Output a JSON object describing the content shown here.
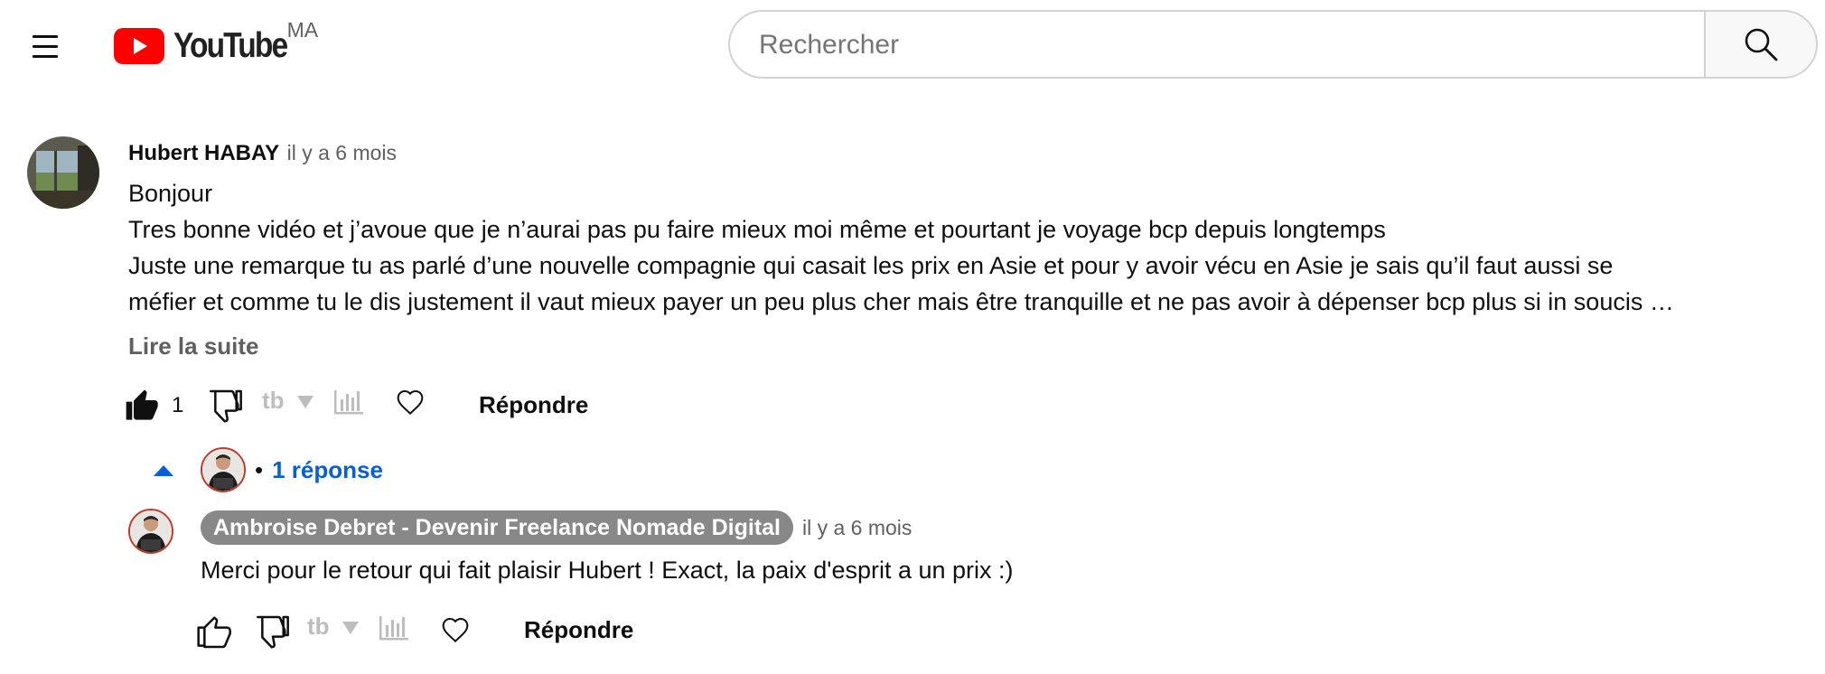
{
  "header": {
    "logo_text": "YouTube",
    "country_code": "MA",
    "search_placeholder": "Rechercher",
    "colors": {
      "logo_red": "#ff0000"
    }
  },
  "comment": {
    "author": "Hubert HABAY",
    "time": "il y a 6 mois",
    "lines": [
      "Bonjour",
      "Tres bonne vidéo et j’avoue que je n’aurai pas pu faire mieux moi même et pourtant je voyage bcp depuis longtemps",
      "Juste une remarque tu as parlé d’une nouvelle compagnie qui casait les prix en Asie et pour y avoir vécu en Asie je sais qu’il faut aussi se",
      "méfier et comme tu le dis justement il vaut mieux payer un peu plus cher mais être tranquille et ne pas avoir à dépenser bcp plus si in soucis …"
    ],
    "read_more": "Lire la suite",
    "like_count": "1",
    "reply_label": "Répondre",
    "replies_toggle": "1 réponse",
    "replies_bullet": "•"
  },
  "reply": {
    "author": "Ambroise Debret - Devenir Freelance Nomade Digital",
    "time": "il y a 6 mois",
    "text": "Merci pour le retour qui fait plaisir Hubert ! Exact, la paix d'esprit a un prix :)",
    "reply_label": "Répondre"
  },
  "icons": [
    "menu-icon",
    "youtube-logo-icon",
    "search-icon",
    "thumb-up-filled-icon",
    "thumb-down-icon",
    "tubebuddy-icon",
    "dropdown-icon",
    "stats-icon",
    "heart-icon",
    "chevron-up-icon",
    "thumb-up-icon"
  ],
  "colors": {
    "link_blue": "#065fd4",
    "chip_gray": "#888888",
    "muted_text": "#606060",
    "ext_icon_gray": "#bdbdbd"
  }
}
